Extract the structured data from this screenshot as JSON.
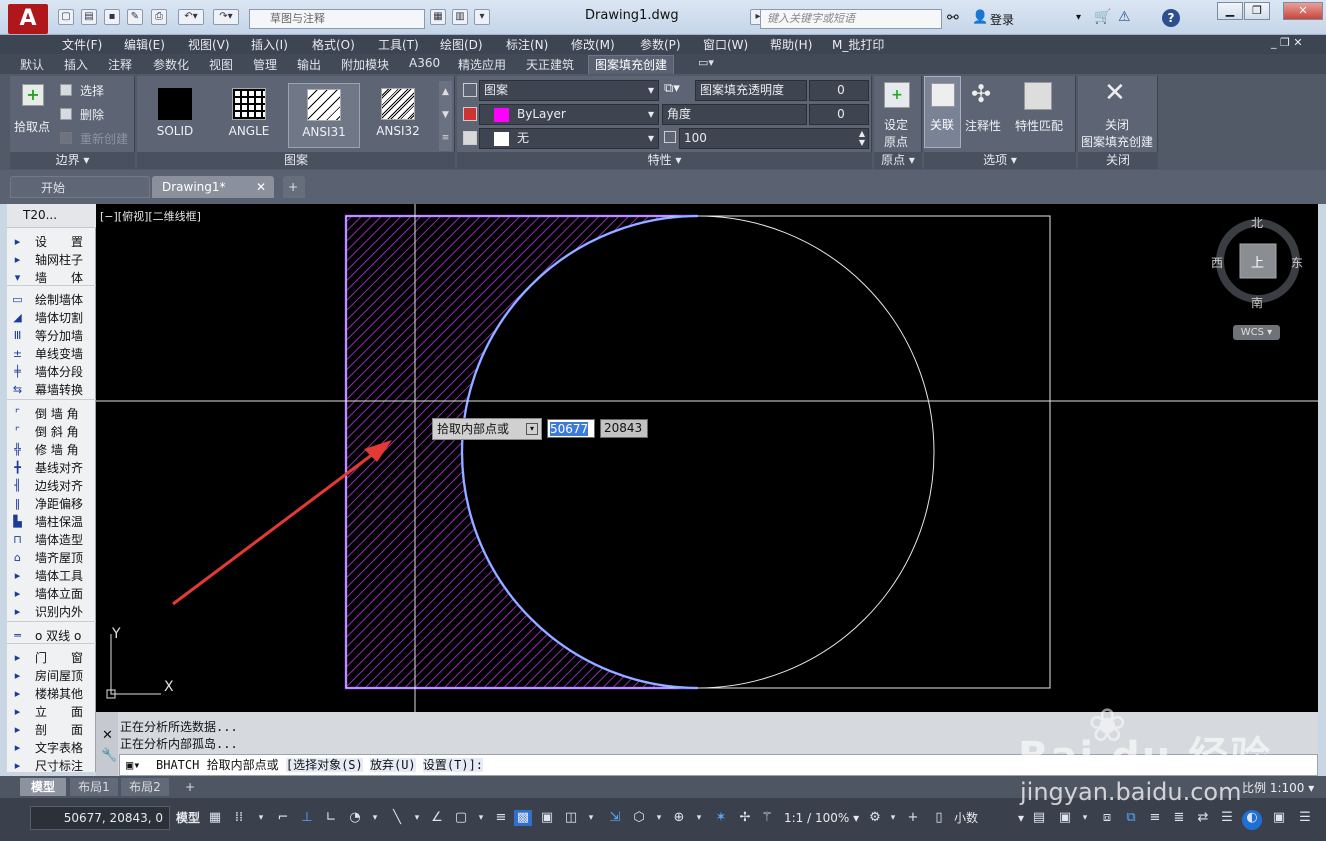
{
  "app": {
    "logo": "A",
    "title": "Drawing1.dwg",
    "workspace_placeholder": "草图与注释",
    "search_placeholder": "键入关键字或短语",
    "login": "登录"
  },
  "menu": [
    "文件(F)",
    "编辑(E)",
    "视图(V)",
    "插入(I)",
    "格式(O)",
    "工具(T)",
    "绘图(D)",
    "标注(N)",
    "修改(M)",
    "参数(P)",
    "窗口(W)",
    "帮助(H)",
    "M_批打印"
  ],
  "ribbon_tabs": [
    "默认",
    "插入",
    "注释",
    "参数化",
    "视图",
    "管理",
    "输出",
    "附加模块",
    "A360",
    "精选应用",
    "天正建筑",
    "图案填充创建"
  ],
  "ribbon_active": "图案填充创建",
  "ribbon": {
    "boundary": {
      "pick": "拾取点",
      "select": "选择",
      "remove": "删除",
      "recreate": "重新创建",
      "label": "边界 ▾"
    },
    "patterns": [
      {
        "name": "SOLID"
      },
      {
        "name": "ANGLE"
      },
      {
        "name": "ANSI31"
      },
      {
        "name": "ANSI32"
      }
    ],
    "pattern_label": "图案",
    "props": {
      "type": "图案",
      "color": "ByLayer",
      "bg": "无",
      "transparency_label": "图案填充透明度",
      "transparency": "0",
      "angle_label": "角度",
      "angle": "0",
      "scale": "100",
      "label": "特性 ▾"
    },
    "origin": {
      "set": "设定",
      "set2": "原点",
      "label": "原点 ▾"
    },
    "options": {
      "assoc": "关联",
      "annot": "注释性",
      "match": "特性匹配",
      "label": "选项 ▾"
    },
    "close": {
      "l1": "关闭",
      "l2": "图案填充创建",
      "label": "关闭"
    }
  },
  "doc_tabs": [
    {
      "label": "开始"
    },
    {
      "label": "Drawing1*"
    }
  ],
  "tool_panel": {
    "header": "T20...",
    "items": [
      {
        "icon": "▸",
        "label": "设　　置"
      },
      {
        "icon": "▸",
        "label": "轴网柱子"
      },
      {
        "icon": "▾",
        "label": "墙　　体"
      },
      {
        "icon": "▭",
        "label": "绘制墙体"
      },
      {
        "icon": "◢",
        "label": "墙体切割"
      },
      {
        "icon": "Ⅲ",
        "label": "等分加墙"
      },
      {
        "icon": "±",
        "label": "单线变墙"
      },
      {
        "icon": "╪",
        "label": "墙体分段"
      },
      {
        "icon": "⇆",
        "label": "幕墙转换"
      },
      {
        "icon": "⌜",
        "label": "倒 墙 角"
      },
      {
        "icon": "⌜",
        "label": "倒 斜 角"
      },
      {
        "icon": "╬",
        "label": "修 墙 角"
      },
      {
        "icon": "╋",
        "label": "基线对齐"
      },
      {
        "icon": "╢",
        "label": "边线对齐"
      },
      {
        "icon": "‖",
        "label": "净距偏移"
      },
      {
        "icon": "▙",
        "label": "墙柱保温"
      },
      {
        "icon": "⊓",
        "label": "墙体造型"
      },
      {
        "icon": "⌂",
        "label": "墙齐屋顶"
      },
      {
        "icon": "▸",
        "label": "墙体工具"
      },
      {
        "icon": "▸",
        "label": "墙体立面"
      },
      {
        "icon": "▸",
        "label": "识别内外"
      },
      {
        "icon": "═",
        "label": "o 双线 o"
      },
      {
        "icon": "▸",
        "label": "门　　窗"
      },
      {
        "icon": "▸",
        "label": "房间屋顶"
      },
      {
        "icon": "▸",
        "label": "楼梯其他"
      },
      {
        "icon": "▸",
        "label": "立　　面"
      },
      {
        "icon": "▸",
        "label": "剖　　面"
      },
      {
        "icon": "▸",
        "label": "文字表格"
      },
      {
        "icon": "▸",
        "label": "尺寸标注"
      }
    ]
  },
  "viewport": {
    "label": "[−][俯视][二维线框]",
    "viewcube": {
      "north": "北",
      "south": "南",
      "west": "西",
      "east": "东",
      "top": "上",
      "wcs": "WCS"
    },
    "ucs": {
      "x": "X",
      "y": "Y"
    },
    "tooltip": {
      "prompt": "拾取内部点或",
      "x": "50677",
      "y": "20843"
    }
  },
  "command": {
    "history": [
      "正在分析所选数据...",
      "正在分析内部孤岛..."
    ],
    "prefix": "BHATCH",
    "prompt": "拾取内部点或",
    "opt1": "[选择对象(S)",
    "opt2": "放弃(U)",
    "opt3": "设置(T)]:"
  },
  "layout_tabs": [
    {
      "label": "模型"
    },
    {
      "label": "布局1"
    },
    {
      "label": "布局2"
    }
  ],
  "scale": "比例 1:100",
  "status": {
    "coords": "50677, 20843, 0",
    "model": "模型",
    "anno_scale": "1:1 / 100%",
    "units": "小数"
  },
  "watermark": {
    "brand": "Bai du 经验",
    "url": "jingyan.baidu.com"
  },
  "colors": {
    "hatch": "#c040ff",
    "accent": "#2b82d9",
    "arrow": "#e03030"
  }
}
